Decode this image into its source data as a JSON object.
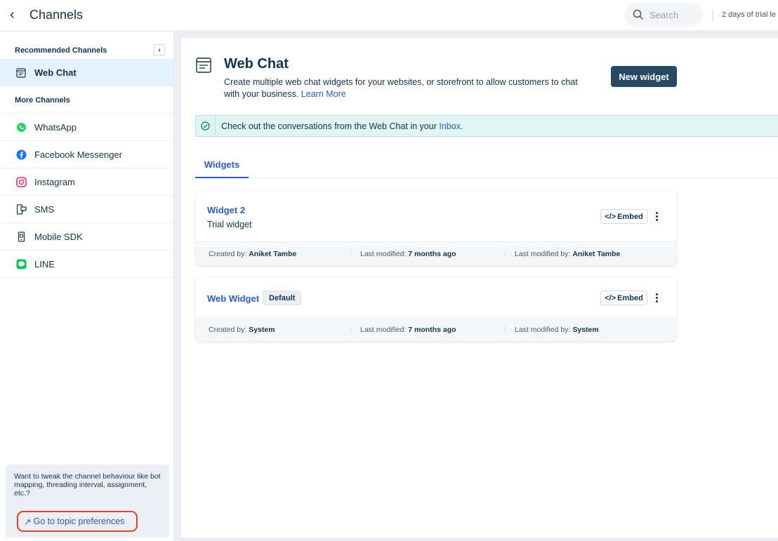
{
  "topbar": {
    "title": "Channels",
    "search_placeholder": "Search",
    "trial_text": "2 days of trial le"
  },
  "sidebar": {
    "recommended_heading": "Recommended Channels",
    "active_item": {
      "label": "Web Chat",
      "icon": "webchat-icon"
    },
    "more_heading": "More Channels",
    "items": [
      {
        "label": "WhatsApp",
        "icon": "whatsapp-icon"
      },
      {
        "label": "Facebook Messenger",
        "icon": "facebook-messenger-icon"
      },
      {
        "label": "Instagram",
        "icon": "instagram-icon"
      },
      {
        "label": "SMS",
        "icon": "sms-icon"
      },
      {
        "label": "Mobile SDK",
        "icon": "mobile-sdk-icon"
      },
      {
        "label": "LINE",
        "icon": "line-icon"
      }
    ],
    "tip": {
      "text": "Want to tweak the channel behaviour like bot mapping, threading interval, assignment, etc.?",
      "link_label": "Go to topic preferences"
    }
  },
  "main": {
    "title": "Web Chat",
    "description": "Create multiple web chat widgets for your websites, or storefront to allow customers to chat with your business.",
    "learn_more": "Learn More",
    "new_widget_label": "New widget",
    "banner_text": "Check out the conversations from the Web Chat in your",
    "banner_link": "Inbox.",
    "tab_label": "Widgets",
    "widgets": [
      {
        "name": "Widget 2",
        "description": "Trial widget",
        "embed_label": "Embed",
        "created_by_label": "Created by:",
        "created_by": "Aniket Tambe",
        "last_modified_label": "Last modified:",
        "last_modified": "7 months ago",
        "last_modified_by_label": "Last modified by:",
        "last_modified_by": "Aniket Tambe"
      },
      {
        "name": "Web Widget",
        "badge": "Default",
        "embed_label": "Embed",
        "created_by_label": "Created by:",
        "created_by": "System",
        "last_modified_label": "Last modified:",
        "last_modified": "7 months ago",
        "last_modified_by_label": "Last modified by:",
        "last_modified_by": "System"
      }
    ]
  },
  "colors": {
    "primary_text": "#12344d",
    "link": "#2c5cc5",
    "button_bg": "#264966",
    "active_bg": "#e5f2fd",
    "banner_bg": "#e0f5f1",
    "highlight_ring": "#d7452c"
  }
}
